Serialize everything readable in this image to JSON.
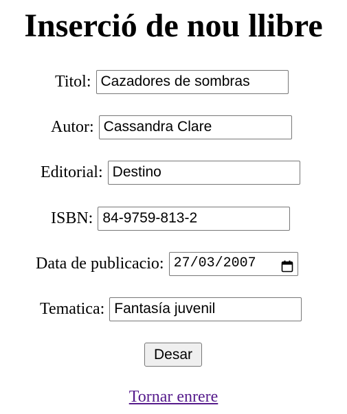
{
  "page": {
    "title": "Inserció de nou llibre"
  },
  "form": {
    "fields": [
      {
        "label": "Titol:",
        "value": "Cazadores de sombras"
      },
      {
        "label": "Autor:",
        "value": "Cassandra Clare"
      },
      {
        "label": "Editorial:",
        "value": "Destino"
      },
      {
        "label": "ISBN:",
        "value": "84-9759-813-2"
      },
      {
        "label": "Data de publicacio:",
        "value": "27/03/2007",
        "icon": "calendar-icon"
      },
      {
        "label": "Tematica:",
        "value": "Fantasía juvenil"
      }
    ],
    "submit_label": "Desar"
  },
  "nav": {
    "back_link": "Tornar enrere"
  },
  "colors": {
    "link": "#551a8b",
    "button_bg": "#efefef",
    "field_border": "#767676"
  }
}
